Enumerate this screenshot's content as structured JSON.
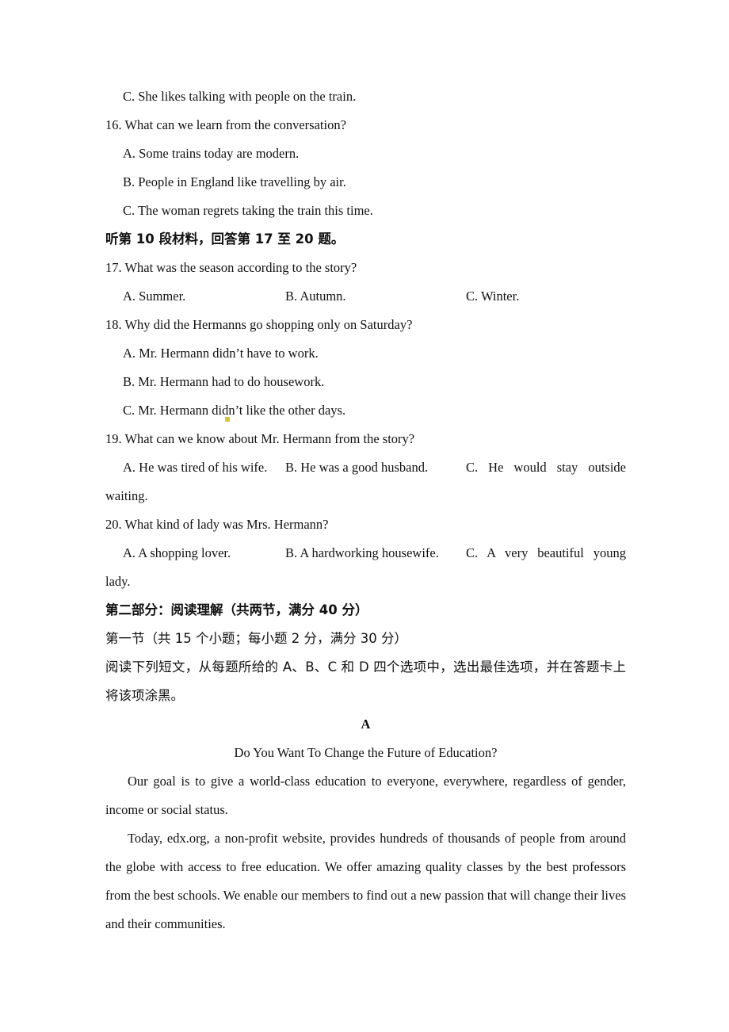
{
  "document": {
    "type": "english-exam-paper-page",
    "background_color": "#ffffff",
    "text_color": "#111111"
  },
  "listening": {
    "q15_option_c": "C. She likes talking with people on the train.",
    "q16": {
      "stem": "16. What can we learn from the conversation?",
      "options": [
        "A. Some trains today are modern.",
        "B. People in England like travelling by air.",
        "C. The woman regrets taking the train this time."
      ]
    },
    "section_heading_10": "听第 10 段材料，回答第 17 至 20 题。",
    "q17": {
      "stem": "17. What was the season according to the story?",
      "option_a": "A. Summer.",
      "option_b": "B. Autumn.",
      "option_c": "C. Winter."
    },
    "q18": {
      "stem": "18. Why did the Hermanns go shopping only on Saturday?",
      "options": [
        "A. Mr. Hermann didn’t have to work.",
        "B. Mr. Hermann had to do housework.",
        "C. Mr. Hermann didn’t like the other days."
      ]
    },
    "q19": {
      "stem": "19. What can we know about Mr. Hermann from the story?",
      "option_a": "A. He was tired of his wife.",
      "option_b": "B. He was a good husband.",
      "option_c": "C. He would stay outside",
      "option_c_cont": "waiting."
    },
    "q20": {
      "stem": "20. What kind of lady was Mrs. Hermann?",
      "option_a": "A. A shopping lover.",
      "option_b": "B. A hardworking housewife.",
      "option_c": "C. A very beautiful young",
      "option_c_cont": "lady."
    }
  },
  "part_two": {
    "heading": "第二部分：阅读理解（共两节，满分 40 分）",
    "section_one_heading": "第一节（共 15 个小题；每小题 2 分，满分 30 分）",
    "instructions": "阅读下列短文，从每题所给的 A、B、C 和 D 四个选项中，选出最佳选项，并在答题卡上将该项涂黑。"
  },
  "passage_a": {
    "letter": "A",
    "title": "Do You Want To Change the Future of Education?",
    "paragraph_1": "Our goal is to give a world-class education to everyone, everywhere, regardless of gender, income or social status.",
    "paragraph_2": "Today, edx.org, a non-profit website, provides hundreds of thousands of people from around the globe with access to free education. We offer amazing quality classes by the best professors from the best schools. We enable our members to find out a new passion that will change their lives and their communities."
  }
}
